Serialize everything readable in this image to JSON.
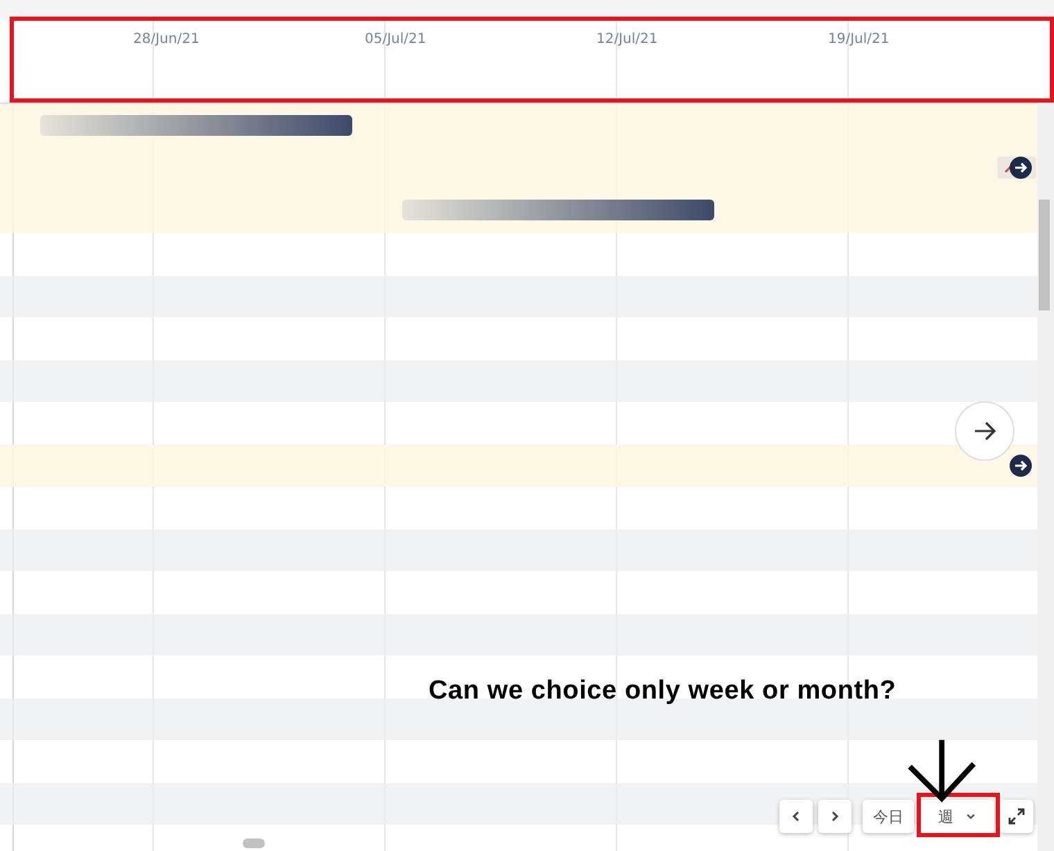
{
  "timeline": {
    "columns": [
      "28/Jun/21",
      "05/Jul/21",
      "12/Jul/21",
      "19/Jul/21"
    ]
  },
  "rows": [
    {
      "kind": "event"
    },
    {
      "kind": "plain"
    },
    {
      "kind": "striped"
    },
    {
      "kind": "plain"
    },
    {
      "kind": "striped"
    },
    {
      "kind": "plain"
    },
    {
      "kind": "highlight"
    },
    {
      "kind": "plain"
    },
    {
      "kind": "striped"
    },
    {
      "kind": "plain"
    },
    {
      "kind": "striped"
    },
    {
      "kind": "plain"
    },
    {
      "kind": "striped"
    },
    {
      "kind": "plain"
    },
    {
      "kind": "striped"
    },
    {
      "kind": "plain"
    }
  ],
  "controls": {
    "today": "今日",
    "scale": "週"
  },
  "annotation": {
    "note": "Can we choice only week or month?"
  }
}
